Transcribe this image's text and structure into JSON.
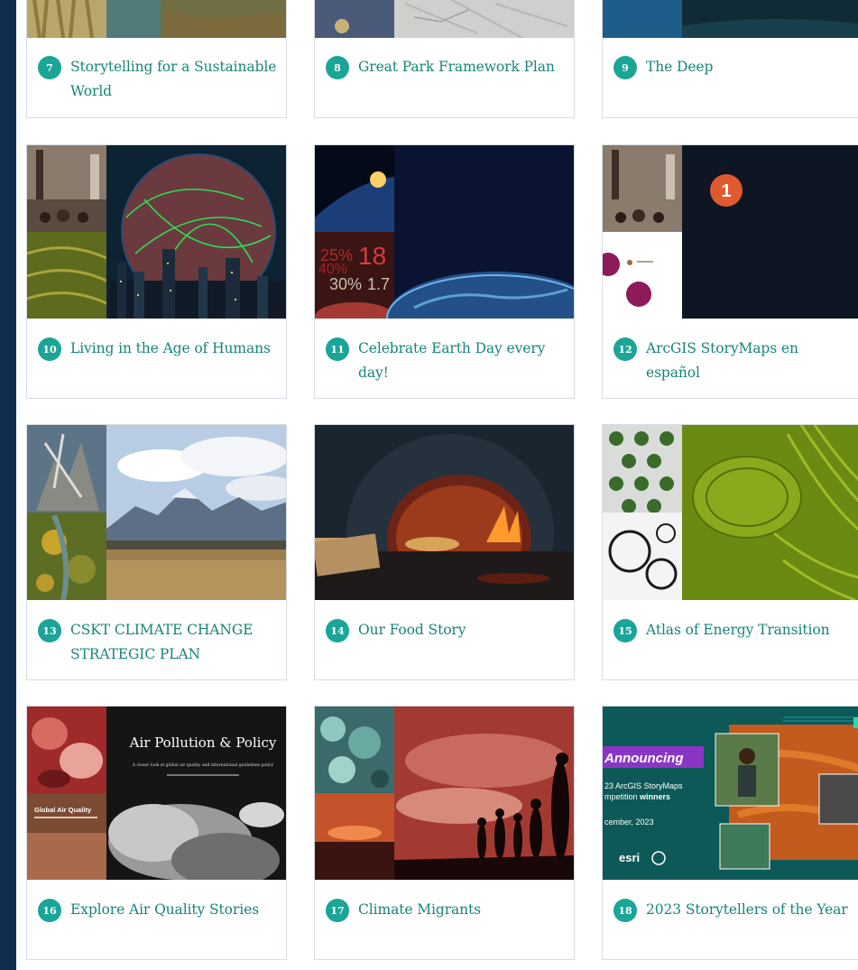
{
  "colors": {
    "background": "#0f2d4f",
    "accent": "#1aa597",
    "title_text": "#17857a",
    "card_border": "#d6dde3"
  },
  "cards": [
    {
      "number": "7",
      "title": "Storytelling for a Sustainable World"
    },
    {
      "number": "8",
      "title": "Great Park Framework Plan"
    },
    {
      "number": "9",
      "title": "The Deep"
    },
    {
      "number": "10",
      "title": "Living in the Age of Humans"
    },
    {
      "number": "11",
      "title": "Celebrate Earth Day every day!"
    },
    {
      "number": "12",
      "title": "ArcGIS StoryMaps en español"
    },
    {
      "number": "13",
      "title": "CSKT CLIMATE CHANGE STRATEGIC PLAN"
    },
    {
      "number": "14",
      "title": "Our Food Story"
    },
    {
      "number": "15",
      "title": "Atlas of Energy Transition"
    },
    {
      "number": "16",
      "title": "Explore Air Quality Stories"
    },
    {
      "number": "17",
      "title": "Climate Migrants"
    },
    {
      "number": "18",
      "title": "2023 Storytellers of the Year"
    }
  ],
  "thumbnail_text": {
    "card11_stats": [
      "25%",
      "18",
      "40%",
      "30%",
      "1.7"
    ],
    "card12_marker": "1",
    "card16_title": "Air Pollution & Policy",
    "card16_subtitle": "A closer look at global air quality and international guidelines policy",
    "card16_small_panel": "Global Air Quality",
    "card18_announcing": "Announcing",
    "card18_line1": "23 ArcGIS StoryMaps",
    "card18_line2a": "mpetition ",
    "card18_line2b": "winners",
    "card18_date": "cember, 2023",
    "card18_logo": "esri"
  }
}
